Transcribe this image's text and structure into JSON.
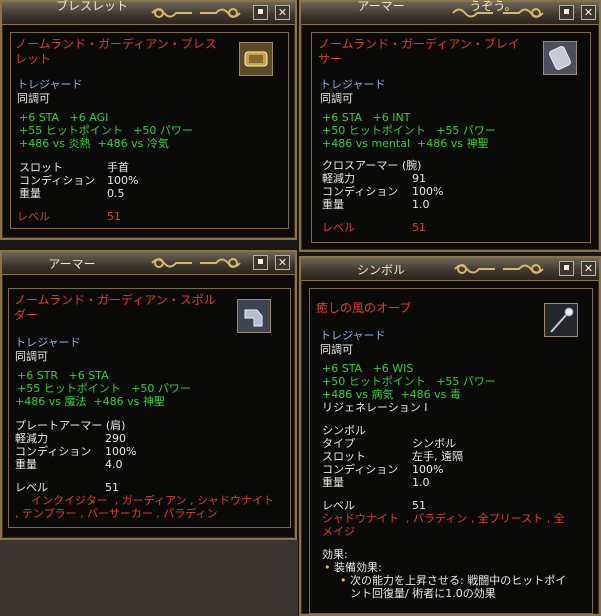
{
  "panels": {
    "bracelet": {
      "title": "ブレスレット",
      "name": "ノームランド・ガーディアン・ブレスレット",
      "name_lines": [
        "ノームランド・ガーディアン・ブレス",
        "レット"
      ],
      "treasured": "トレジャード",
      "attuneable": "同調可",
      "stats": [
        "+6 STA   +6 AGI",
        "+55 ヒットポイント   +50 パワー",
        "+486 vs 炎熱  +486 vs 冷気"
      ],
      "attrs": [
        [
          "スロット",
          "手首"
        ],
        [
          "コンディション",
          "100%"
        ],
        [
          "重量",
          "0.5"
        ]
      ],
      "level_label": "レベル",
      "level_value": "51",
      "icon": "bracelet-icon"
    },
    "bracer": {
      "title": "アーマー",
      "title_extra": "うぞう。",
      "name_lines": [
        "ノームランド・ガーディアン・ブレイ",
        "サー"
      ],
      "treasured": "トレジャード",
      "attuneable": "同調可",
      "stats": [
        "+6 STA   +6 INT",
        "+50 ヒットポイント   +55 パワー",
        "+486 vs mental  +486 vs 神聖"
      ],
      "attrs": [
        [
          "クロスアーマー (腕)",
          ""
        ],
        [
          "軽減力",
          "91"
        ],
        [
          "コンディション",
          "100%"
        ],
        [
          "重量",
          "1.0"
        ]
      ],
      "level_label": "レベル",
      "level_value": "51",
      "icon": "bracer-icon"
    },
    "spaulder": {
      "title": "アーマー",
      "name_lines": [
        "ノームランド・ガーディアン・スポル",
        "ダー"
      ],
      "treasured": "トレジャード",
      "attuneable": "同調可",
      "stats": [
        "+6 STR   +6 STA",
        "+55 ヒットポイント   +50 パワー",
        "+486 vs 魔法  +486 vs 神聖"
      ],
      "attrs": [
        [
          "プレートアーマー (肩)",
          ""
        ],
        [
          "軽減力",
          "290"
        ],
        [
          "コンディション",
          "100%"
        ],
        [
          "重量",
          "4.0"
        ]
      ],
      "level_label": "レベル",
      "level_value": "51",
      "classes": [
        "インクイジター  , ガーディアン , シャドウナイト",
        ", テンプラー , バーサーカー , パラディン"
      ],
      "icon": "spaulder-icon"
    },
    "symbol": {
      "title": "シンボル",
      "name": "癒しの風のオーブ",
      "treasured": "トレジャード",
      "attuneable": "同調可",
      "stats": [
        "+6 STA   +6 WIS",
        "+50 ヒットポイント   +55 パワー",
        "+486 vs 病気  +486 vs 毒"
      ],
      "regen": "リジェネレーション I",
      "attrs": [
        [
          "シンボル",
          ""
        ],
        [
          "タイプ",
          "シンボル"
        ],
        [
          "スロット",
          "左手, 遠隔"
        ],
        [
          "コンディション",
          "100%"
        ],
        [
          "重量",
          "1.0"
        ]
      ],
      "level_label": "レベル",
      "level_value": "51",
      "classes": [
        "シャドウナイト  , パラディン , 全プリースト , 全",
        "メイジ"
      ],
      "effects_label": "効果:",
      "equip_label": "装備効果:",
      "effect_lines": [
        "次の能力を上昇させる: 戦闘中のヒットポイ",
        "ント回復量/ 術者に1.0の効果"
      ],
      "icon": "orb-staff-icon"
    }
  }
}
